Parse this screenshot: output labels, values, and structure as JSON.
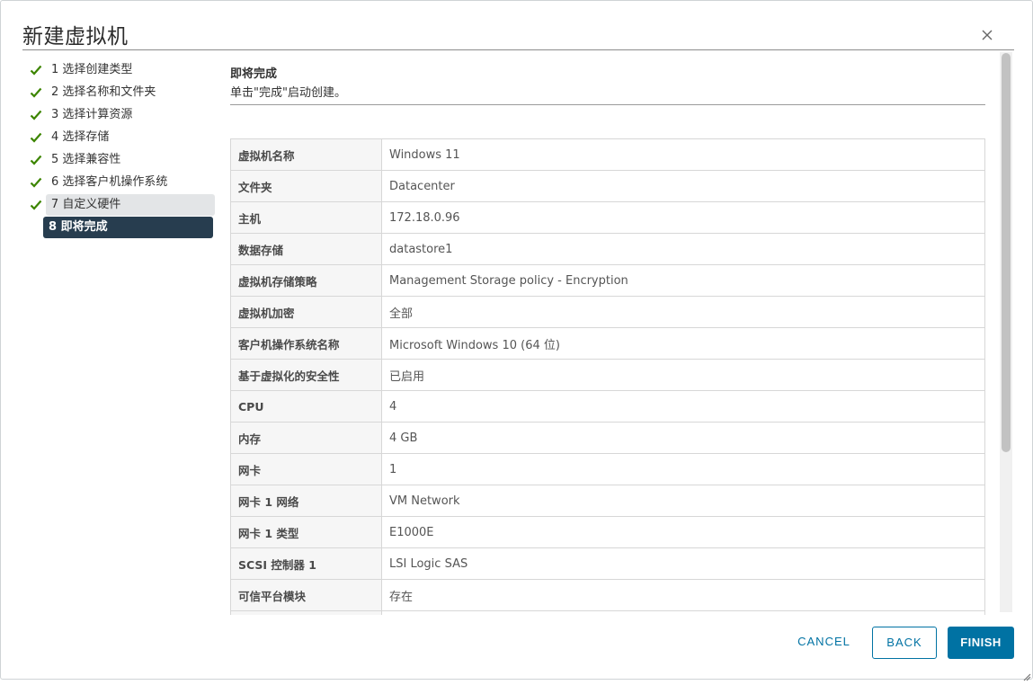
{
  "dialog": {
    "title": "新建虚拟机"
  },
  "steps": [
    {
      "label": "1 选择创建类型",
      "done": true
    },
    {
      "label": "2 选择名称和文件夹",
      "done": true
    },
    {
      "label": "3 选择计算资源",
      "done": true
    },
    {
      "label": "4 选择存储",
      "done": true
    },
    {
      "label": "5 选择兼容性",
      "done": true
    },
    {
      "label": "6 选择客户机操作系统",
      "done": true
    },
    {
      "label": "7 自定义硬件",
      "done": true
    },
    {
      "label": "8 即将完成",
      "done": false
    }
  ],
  "content": {
    "heading": "即将完成",
    "subtitle": "单击\"完成\"启动创建。"
  },
  "summary": [
    {
      "key": "虚拟机名称",
      "value": "Windows 11"
    },
    {
      "key": "文件夹",
      "value": "Datacenter"
    },
    {
      "key": "主机",
      "value": "172.18.0.96"
    },
    {
      "key": "数据存储",
      "value": "datastore1"
    },
    {
      "key": "虚拟机存储策略",
      "value": "Management Storage policy - Encryption"
    },
    {
      "key": "虚拟机加密",
      "value": "全部"
    },
    {
      "key": "客户机操作系统名称",
      "value": "Microsoft Windows 10 (64 位)"
    },
    {
      "key": "基于虚拟化的安全性",
      "value": "已启用"
    },
    {
      "key": "CPU",
      "value": "4"
    },
    {
      "key": "内存",
      "value": "4 GB"
    },
    {
      "key": "网卡",
      "value": "1"
    },
    {
      "key": "网卡 1 网络",
      "value": "VM Network"
    },
    {
      "key": "网卡 1 类型",
      "value": "E1000E"
    },
    {
      "key": "SCSI 控制器 1",
      "value": "LSI Logic SAS"
    },
    {
      "key": "可信平台模块",
      "value": "存在"
    },
    {
      "key": "",
      "value": ""
    }
  ],
  "footer": {
    "cancel_label": "CANCEL",
    "back_label": "BACK",
    "finish_label": "FINISH"
  },
  "colors": {
    "accent": "#0072a3",
    "check": "#3c8500",
    "current_step": "#273d4f"
  },
  "icons": {
    "close": "close-icon",
    "check": "check-icon",
    "resize": "resize-handle-icon"
  }
}
